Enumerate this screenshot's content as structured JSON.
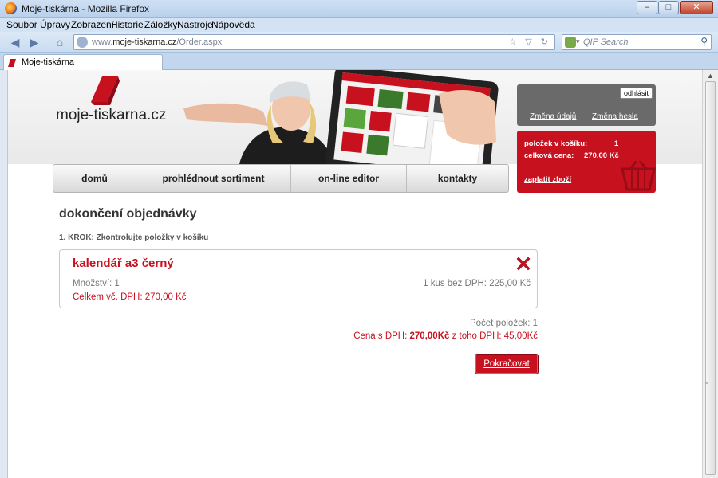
{
  "window": {
    "title": "Moje-tiskárna - Mozilla Firefox",
    "min_label": "–",
    "max_label": "□",
    "close_label": "✕"
  },
  "menu": [
    "Soubor",
    "Úpravy",
    "Zobrazení",
    "Historie",
    "Záložky",
    "Nástroje",
    "Nápověda"
  ],
  "address": {
    "url_prefix": "www.",
    "url_domain": "moje-tiskarna.cz",
    "url_path": "/Order.aspx",
    "icons": "☆ ▽ ↻"
  },
  "search": {
    "placeholder": "QIP Search",
    "engine_arrow": "▾"
  },
  "tab": {
    "label": "Moje-tiskárna"
  },
  "site": {
    "logo": "moje-tiskarna.cz",
    "nav": [
      "domů",
      "prohlédnout sortiment",
      "on-line editor",
      "kontakty"
    ]
  },
  "user_panel": {
    "logout": "odhlásit",
    "change_details": "Změna údajů",
    "change_password": "Změna hesla"
  },
  "cart": {
    "items_label": "položek v košíku:",
    "items_value": "1",
    "total_label": "celková cena:",
    "total_value": "270,00 Kč",
    "pay_link": "zaplatit zboží"
  },
  "order": {
    "page_title": "dokončení objednávky",
    "step": "1. KROK: Zkontrolujte položky v košíku",
    "item": {
      "name": "kalendář a3 černý",
      "quantity": "Množství: 1",
      "unit_price": "1 kus bez DPH: 225,00 Kč",
      "total": "Celkem vč. DPH: 270,00 Kč"
    },
    "summary": {
      "count": "Počet položek: 1",
      "price_label": "Cena s DPH:",
      "price_value": "270,00Kč",
      "vat_text": "z toho DPH: 45,00Kč"
    },
    "continue": "Pokračovat"
  },
  "colors": {
    "brand_red": "#c8111f",
    "panel_gray": "#6a6a6a"
  }
}
